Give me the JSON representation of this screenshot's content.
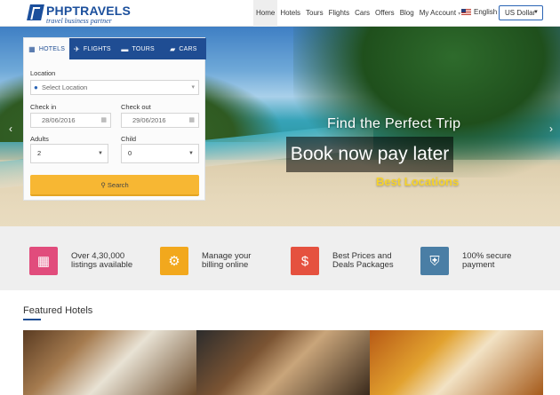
{
  "header": {
    "logo_title": "PHPTRAVELS",
    "logo_subtitle": "travel business partner",
    "nav": [
      "Home",
      "Hotels",
      "Tours",
      "Flights",
      "Cars",
      "Offers",
      "Blog",
      "My Account"
    ],
    "active_nav": "Home",
    "language": "English",
    "currency": "US Dollar"
  },
  "hero": {
    "tagline": "Find the Perfect Trip",
    "headline": "Book now pay later",
    "subline": "Best Locations"
  },
  "search": {
    "tabs": [
      {
        "label": "HOTELS",
        "icon": "building-icon",
        "active": true
      },
      {
        "label": "FLIGHTS",
        "icon": "plane-icon",
        "active": false
      },
      {
        "label": "TOURS",
        "icon": "suitcase-icon",
        "active": false
      },
      {
        "label": "CARS",
        "icon": "car-icon",
        "active": false
      }
    ],
    "location_label": "Location",
    "location_placeholder": "Select Location",
    "checkin_label": "Check in",
    "checkin_value": "28/06/2016",
    "checkout_label": "Check out",
    "checkout_value": "29/06/2016",
    "adults_label": "Adults",
    "adults_value": "2",
    "child_label": "Child",
    "child_value": "0",
    "search_button": "Search"
  },
  "features": [
    {
      "line1": "Over 4,30,000",
      "line2": "listings available",
      "color": "#e14c7c",
      "icon": "building-icon"
    },
    {
      "line1": "Manage your",
      "line2": "billing online",
      "color": "#f2a81d",
      "icon": "gear-icon"
    },
    {
      "line1": "Best Prices and",
      "line2": "Deals Packages",
      "color": "#e5513f",
      "icon": "money-icon"
    },
    {
      "line1": "100% secure",
      "line2": "payment",
      "color": "#4a7ea5",
      "icon": "shield-icon"
    }
  ],
  "featured": {
    "title": "Featured Hotels"
  },
  "colors": {
    "brand": "#1f4d93",
    "search_button": "#f7b733",
    "headline_accent": "#f6d32a"
  }
}
